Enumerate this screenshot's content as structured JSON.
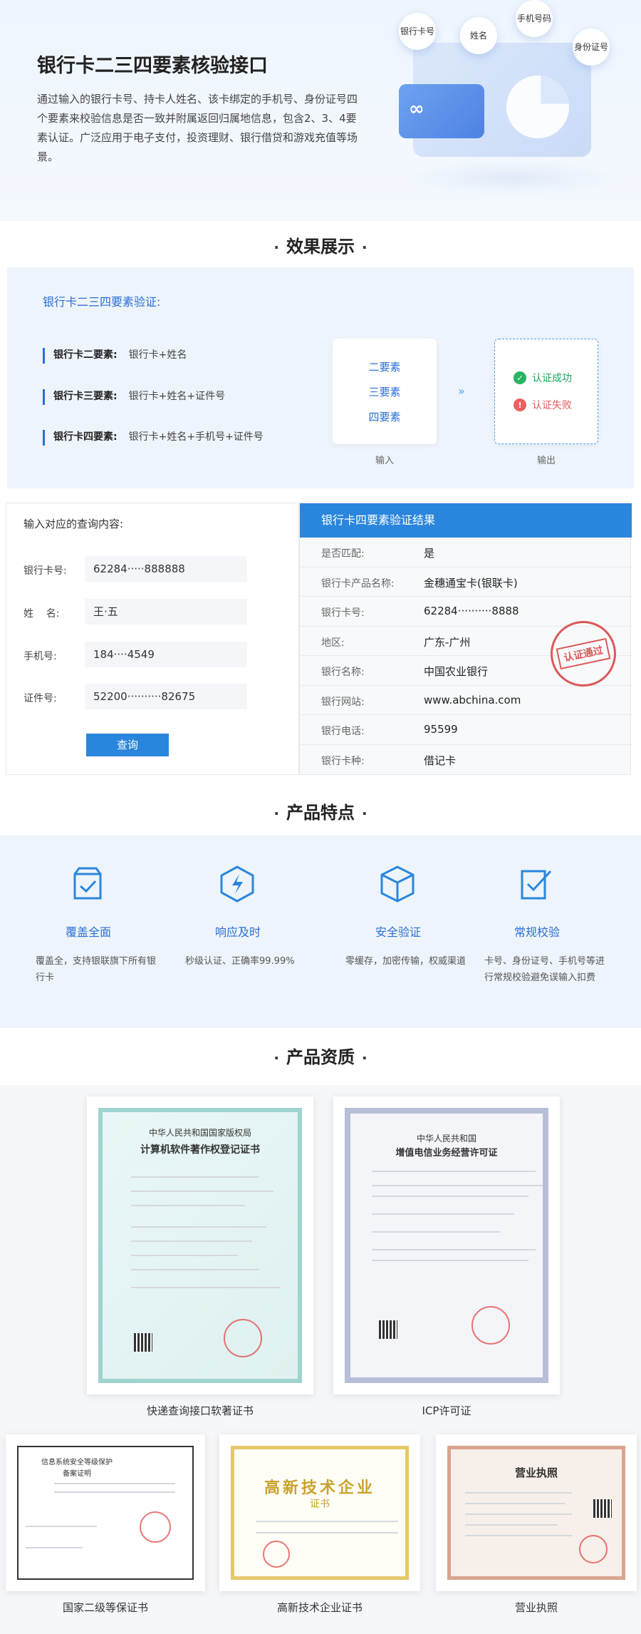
{
  "hero": {
    "title": "银行卡二三四要素核验接口",
    "description": "通过输入的银行卡号、持卡人姓名、该卡绑定的手机号、身份证号四个要素来校验信息是否一致并附属返回归属地信息，包含2、3、4要素认证。广泛应用于电子支付，投资理财、银行借贷和游戏充值等场景。",
    "bubbles": [
      "银行卡号",
      "姓名",
      "手机号码",
      "身份证号"
    ]
  },
  "effect": {
    "section_title": "效果展示",
    "title": "银行卡二三四要素验证:",
    "rows": [
      {
        "key": "银行卡二要素:",
        "value": "银行卡+姓名"
      },
      {
        "key": "银行卡三要素:",
        "value": "银行卡+姓名+证件号"
      },
      {
        "key": "银行卡四要素:",
        "value": "银行卡+姓名+手机号+证件号"
      }
    ],
    "input_items": [
      "二要素",
      "三要素",
      "四要素"
    ],
    "output_success": "认证成功",
    "output_fail": "认证失败",
    "input_label": "输入",
    "output_label": "输出",
    "arrows": "»"
  },
  "query": {
    "title": "输入对应的查询内容:",
    "fields": [
      {
        "label": "银行卡号:",
        "value": "62284·····888888"
      },
      {
        "label": "姓    名:",
        "value": "王·五"
      },
      {
        "label": "手机号:",
        "value": "184····4549"
      },
      {
        "label": "证件号:",
        "value": "52200··········82675"
      }
    ],
    "button": "查询"
  },
  "result": {
    "header": "银行卡四要素验证结果",
    "rows": [
      {
        "key": "是否匹配:",
        "value": "是"
      },
      {
        "key": "银行卡产品名称:",
        "value": "金穗通宝卡(银联卡)"
      },
      {
        "key": "银行卡号:",
        "value": "62284··········8888"
      },
      {
        "key": "地区:",
        "value": "广东-广州"
      },
      {
        "key": "银行名称:",
        "value": "中国农业银行"
      },
      {
        "key": "银行网站:",
        "value": "www.abchina.com"
      },
      {
        "key": "银行电话:",
        "value": "95599"
      },
      {
        "key": "银行卡种:",
        "value": "借记卡"
      }
    ],
    "stamp": "认证通过"
  },
  "features": {
    "section_title": "产品特点",
    "items": [
      {
        "name": "覆盖全面",
        "desc": "覆盖全，支持银联旗下所有银行卡"
      },
      {
        "name": "响应及时",
        "desc": "秒级认证、正确率99.99%"
      },
      {
        "name": "安全验证",
        "desc": "零缓存，加密传输，权威渠道"
      },
      {
        "name": "常规校验",
        "desc": "卡号、身份证号、手机号等进行常规校验避免误输入扣费"
      }
    ]
  },
  "certs": {
    "section_title": "产品资质",
    "items": [
      {
        "caption": "快递查询接口软著证书",
        "heading": "中华人民共和国国家版权局",
        "subheading": "计算机软件著作权登记证书"
      },
      {
        "caption": "ICP许可证",
        "heading": "中华人民共和国",
        "subheading": "增值电信业务经营许可证"
      },
      {
        "caption": "国家二级等保证书",
        "heading": "信息系统安全等级保护",
        "subheading": "备案证明"
      },
      {
        "caption": "高新技术企业证书",
        "heading": "高新技术企业",
        "subheading": "证书"
      },
      {
        "caption": "营业执照",
        "heading": "营业执照",
        "subheading": ""
      }
    ]
  },
  "colors": {
    "accent": "#2a86dc",
    "title_blue": "#2a6fd6",
    "success": "#29b463",
    "fail": "#ef5f5f",
    "stamp": "#d83c3c"
  }
}
